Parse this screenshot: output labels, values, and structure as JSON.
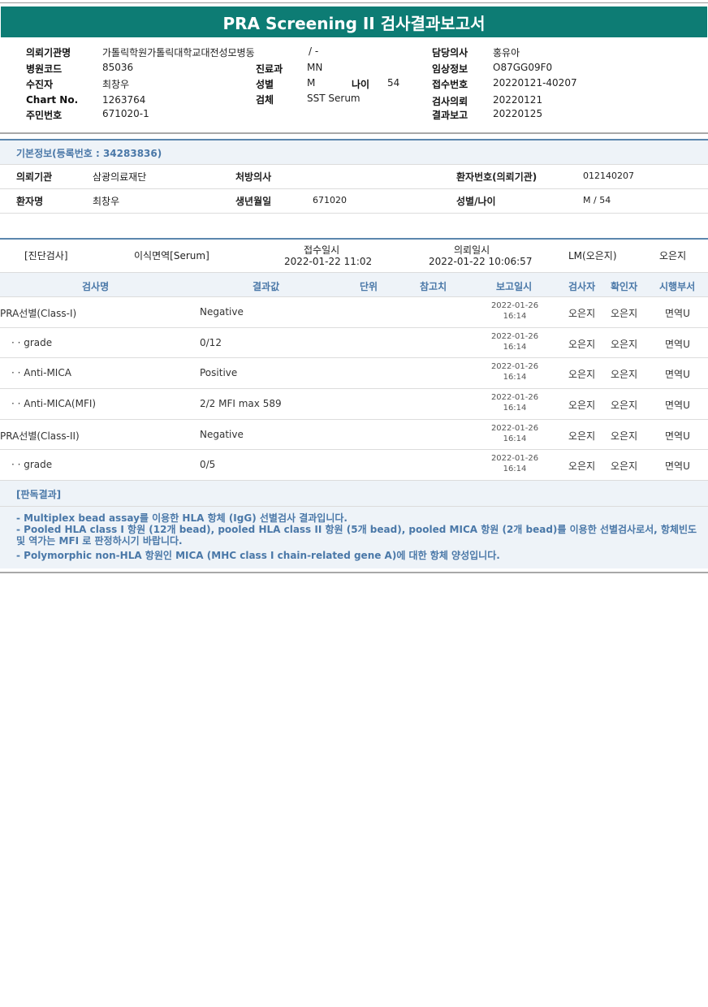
{
  "report_title": "PRA Screening II 검사결과보고서",
  "header": {
    "institution_label": "의뢰기관명",
    "institution_value": "가톨릭학원가톨릭대학교대전성모병동",
    "ward_value": "/ -",
    "doctor_label": "담당의사",
    "doctor_value": "홍유아",
    "hospital_code_label": "병원코드",
    "hospital_code_value": "85036",
    "dept_label": "진료과",
    "dept_value": "MN",
    "clinical_label": "임상정보",
    "clinical_value": "O87GG09F0",
    "patient_label": "수진자",
    "patient_value": "최창우",
    "sex_label": "성별",
    "sex_value": "M",
    "age_label": "나이",
    "age_value": "54",
    "receipt_label": "접수번호",
    "receipt_value": "20220121-40207",
    "chart_label": "Chart No.",
    "chart_value": "1263764",
    "specimen_label": "검체",
    "specimen_value": "SST Serum",
    "request_label": "검사의뢰",
    "request_value": "20220121",
    "rrn_label": "주민번호",
    "rrn_value": "671020-1",
    "report_label": "결과보고",
    "report_value": "20220125"
  },
  "basic": {
    "title": "기본정보(등록번호 : 34283836)",
    "org_label": "의뢰기관",
    "org_value": "삼광의료재단",
    "presc_label": "처방의사",
    "presc_value": "",
    "pid_label": "환자번호(의뢰기관)",
    "pid_value": "012140207",
    "name_label": "환자명",
    "name_value": "최창우",
    "dob_label": "생년월일",
    "dob_value": "671020",
    "sexage_label": "성별/나이",
    "sexage_value": "M / 54"
  },
  "diag": {
    "label": "[진단검사]",
    "dept": "이식면역[Serum]",
    "recv_label": "접수일시",
    "recv_value": "2022-01-22  11:02",
    "req_label": "의뢰일시",
    "req_value": "2022-01-22  10:06:57",
    "lm": "LM(오은지)",
    "person": "오은지"
  },
  "table": {
    "headers": [
      "검사명",
      "결과값",
      "단위",
      "참고치",
      "보고일시",
      "검사자",
      "확인자",
      "시행부서"
    ],
    "rows": [
      {
        "name": "PRA선별(Class-I)",
        "result": "Negative",
        "unit": "",
        "ref": "",
        "date": "2022-01-26",
        "time": "16:14",
        "tester": "오은지",
        "checker": "오은지",
        "dept": "면역U"
      },
      {
        "name": "· · grade",
        "result": "0/12",
        "unit": "",
        "ref": "",
        "date": "2022-01-26",
        "time": "16:14",
        "tester": "오은지",
        "checker": "오은지",
        "dept": "면역U"
      },
      {
        "name": "· · Anti-MICA",
        "result": "Positive",
        "unit": "",
        "ref": "",
        "date": "2022-01-26",
        "time": "16:14",
        "tester": "오은지",
        "checker": "오은지",
        "dept": "면역U"
      },
      {
        "name": "· · Anti-MICA(MFI)",
        "result": "2/2 MFI max 589",
        "unit": "",
        "ref": "",
        "date": "2022-01-26",
        "time": "16:14",
        "tester": "오은지",
        "checker": "오은지",
        "dept": "면역U"
      },
      {
        "name": "PRA선별(Class-II)",
        "result": "Negative",
        "unit": "",
        "ref": "",
        "date": "2022-01-26",
        "time": "16:14",
        "tester": "오은지",
        "checker": "오은지",
        "dept": "면역U"
      },
      {
        "name": "· · grade",
        "result": "0/5",
        "unit": "",
        "ref": "",
        "date": "2022-01-26",
        "time": "16:14",
        "tester": "오은지",
        "checker": "오은지",
        "dept": "면역U"
      }
    ]
  },
  "interpretation": {
    "title": "[판독결과]",
    "lines": [
      "- Multiplex bead assay를 이용한 HLA 항체 (IgG) 선별검사 결과입니다.",
      "- Pooled HLA class I 항원 (12개 bead), pooled HLA class II 항원 (5개 bead), pooled MICA 항원 (2개 bead)를 이용한 선별검사로서, 항체빈도 및 역가는 MFI 로 판정하시기 바랍니다.",
      "- Polymorphic non-HLA 항원인 MICA (MHC class I chain-related gene A)에 대한 항체 양성입니다."
    ]
  }
}
